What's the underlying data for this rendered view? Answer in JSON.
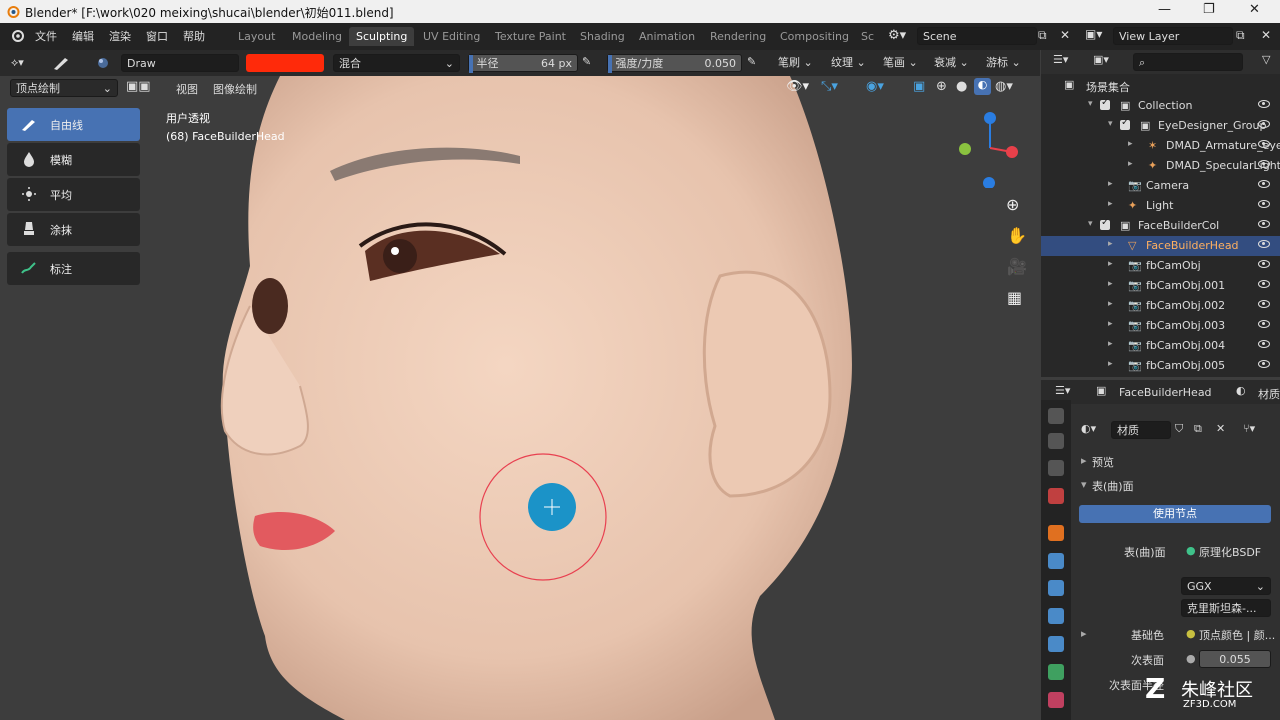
{
  "titlebar": {
    "title": "Blender* [F:\\work\\020 meixing\\shucai\\blender\\初始011.blend]"
  },
  "menu": [
    "文件",
    "编辑",
    "渲染",
    "窗口",
    "帮助"
  ],
  "workspaces": [
    "Layout",
    "Modeling",
    "Sculpting",
    "UV Editing",
    "Texture Paint",
    "Shading",
    "Animation",
    "Rendering",
    "Compositing",
    "Sc"
  ],
  "active_workspace": "Sculpting",
  "scene": "Scene",
  "view_layer": "View Layer",
  "tool_header": {
    "brush_name": "Draw",
    "brush_color": "#ff2a0a",
    "blend_mode": "混合",
    "radius_label": "半径",
    "radius_value": "64 px",
    "strength_label": "强度/力度",
    "strength_value": "0.050",
    "brush_menu": "笔刷",
    "texture_menu": "纹理",
    "stroke_menu": "笔画",
    "falloff_menu": "衰减",
    "cursor_menu": "游标"
  },
  "mode": {
    "label": "顶点绘制",
    "view": "视图",
    "paint": "图像绘制"
  },
  "viewport": {
    "view_name": "用户透视",
    "object_info": "(68) FaceBuilderHead"
  },
  "tools": [
    {
      "label": "自由线",
      "icon": "brush-icon",
      "active": true
    },
    {
      "label": "模糊",
      "icon": "drop-icon",
      "active": false
    },
    {
      "label": "平均",
      "icon": "average-icon",
      "active": false
    },
    {
      "label": "涂抹",
      "icon": "smear-icon",
      "active": false
    },
    {
      "label": "标注",
      "icon": "annotate-icon",
      "active": false
    }
  ],
  "outliner": {
    "root": "场景集合",
    "rows": [
      {
        "name": "Collection",
        "indent": 1,
        "type": "collection"
      },
      {
        "name": "EyeDesigner_Group",
        "indent": 2,
        "type": "collection"
      },
      {
        "name": "DMAD_Armature_eye",
        "indent": 3,
        "type": "armature"
      },
      {
        "name": "DMAD_SpecularLight",
        "indent": 3,
        "type": "light"
      },
      {
        "name": "Camera",
        "indent": 2,
        "type": "camera"
      },
      {
        "name": "Light",
        "indent": 2,
        "type": "light"
      },
      {
        "name": "FaceBuilderCol",
        "indent": 1,
        "type": "collection"
      },
      {
        "name": "FaceBuilderHead",
        "indent": 2,
        "type": "mesh",
        "selected": true
      },
      {
        "name": "fbCamObj",
        "indent": 2,
        "type": "camera"
      },
      {
        "name": "fbCamObj.001",
        "indent": 2,
        "type": "camera"
      },
      {
        "name": "fbCamObj.002",
        "indent": 2,
        "type": "camera"
      },
      {
        "name": "fbCamObj.003",
        "indent": 2,
        "type": "camera"
      },
      {
        "name": "fbCamObj.004",
        "indent": 2,
        "type": "camera"
      },
      {
        "name": "fbCamObj.005",
        "indent": 2,
        "type": "camera"
      }
    ]
  },
  "properties": {
    "object": "FaceBuilderHead",
    "tab_cut": "材质",
    "material": "材质",
    "preview": "预览",
    "surface": "表(曲)面",
    "use_nodes": "使用节点",
    "surface_label": "表(曲)面",
    "surface_value": "原理化BSDF",
    "distribution": "GGX",
    "subsurface_method": "克里斯坦森-...",
    "base_color_label": "基础色",
    "base_color_value": "顶点颜色 | 颜...",
    "subsurface_label": "次表面",
    "subsurface_value": "0.055",
    "subsurface_radius_label": "次表面半径"
  },
  "watermark": {
    "text": "朱峰社区",
    "sub": "ZF3D.COM"
  }
}
